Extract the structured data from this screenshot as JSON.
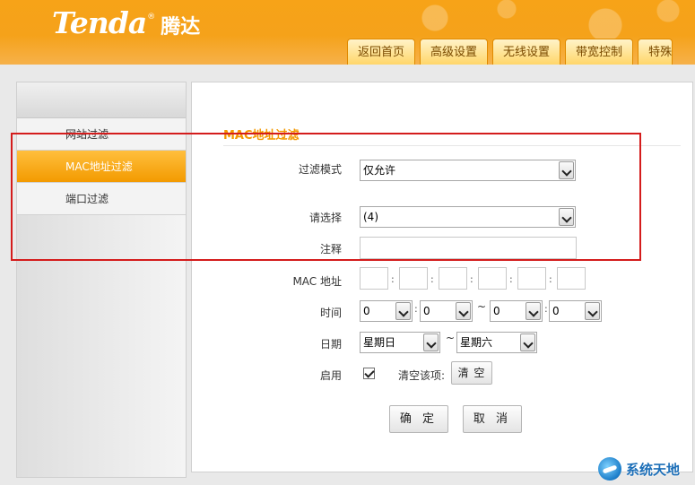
{
  "header": {
    "logo_en": "Tenda",
    "logo_reg": "®",
    "logo_cn": "腾达",
    "tabs": [
      {
        "label": "返回首页"
      },
      {
        "label": "高级设置"
      },
      {
        "label": "无线设置"
      },
      {
        "label": "带宽控制"
      },
      {
        "label": "特殊"
      }
    ]
  },
  "sidebar": {
    "items": [
      {
        "label": "网站过滤",
        "active": false
      },
      {
        "label": "MAC地址过滤",
        "active": true
      },
      {
        "label": "端口过滤",
        "active": false
      }
    ]
  },
  "main": {
    "section_title": "MAC地址过滤",
    "filter_mode": {
      "label": "过滤模式",
      "value": "仅允许"
    },
    "select": {
      "label": "请选择",
      "value": "(4)"
    },
    "note": {
      "label": "注释",
      "value": ""
    },
    "mac": {
      "label": "MAC 地址",
      "separator": ":"
    },
    "time": {
      "label": "时间",
      "start_hour": "0",
      "start_min": "0",
      "end_hour": "0",
      "end_min": "0",
      "range_sep": "~"
    },
    "date": {
      "label": "日期",
      "start": "星期日",
      "end": "星期六",
      "range_sep": "~"
    },
    "enable": {
      "label": "启用",
      "checked": true,
      "clear_label": "清空该项:",
      "clear_button": "清 空"
    },
    "confirm_button": "确 定",
    "cancel_button": "取 消"
  },
  "watermark": {
    "text": "系统天地"
  },
  "colors": {
    "accent": "#f39800",
    "highlight": "#d41c1c",
    "header": "#f7a318"
  }
}
